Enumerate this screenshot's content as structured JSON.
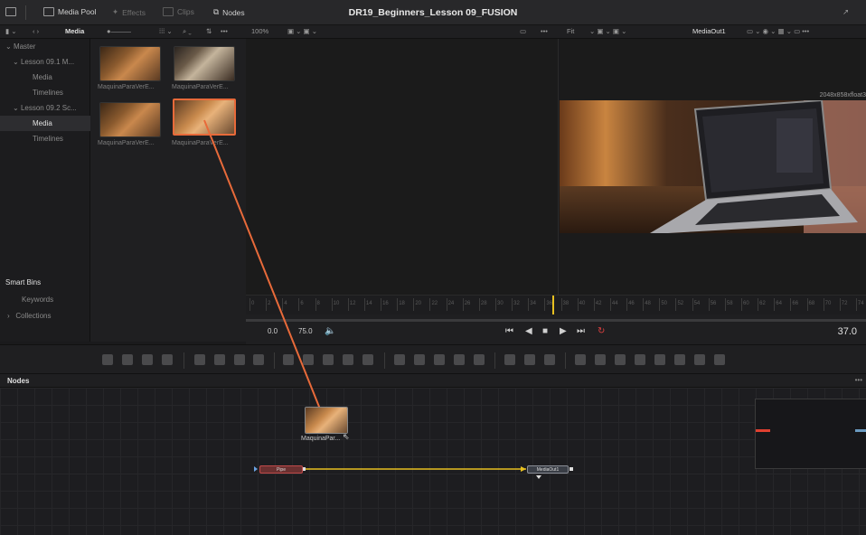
{
  "topbar": {
    "media_pool": "Media Pool",
    "effects": "Effects",
    "clips": "Clips",
    "nodes": "Nodes",
    "project_title": "DR19_Beginners_Lesson 09_FUSION"
  },
  "subbar": {
    "bin_name": "Media",
    "zoom": "100%",
    "fit": "Fit",
    "viewer_node": "MediaOut1"
  },
  "bins": {
    "master": "Master",
    "lesson1": "Lesson 09.1 M...",
    "lesson1_media": "Media",
    "lesson1_timelines": "Timelines",
    "lesson2": "Lesson 09.2 Sc...",
    "lesson2_media": "Media",
    "lesson2_timelines": "Timelines"
  },
  "smart_bins": {
    "title": "Smart Bins",
    "keywords": "Keywords",
    "collections": "Collections"
  },
  "clips": [
    {
      "name": "MaquinaParaVerE..."
    },
    {
      "name": "MaquinaParaVerE..."
    },
    {
      "name": "MaquinaParaVerE..."
    },
    {
      "name": "MaquinaParaVerE..."
    }
  ],
  "viewer": {
    "resolution": "2048x858xfloat3"
  },
  "ruler": {
    "ticks": [
      "0",
      "2",
      "4",
      "6",
      "8",
      "10",
      "12",
      "14",
      "16",
      "18",
      "20",
      "22",
      "24",
      "26",
      "28",
      "30",
      "32",
      "34",
      "36",
      "38",
      "40",
      "42",
      "44",
      "46",
      "48",
      "50",
      "52",
      "54",
      "56",
      "58",
      "60",
      "62",
      "64",
      "66",
      "68",
      "70",
      "72",
      "74"
    ],
    "playhead_frame": 37
  },
  "transport": {
    "start": "0.0",
    "end": "75.0",
    "current_frame": "37.0"
  },
  "nodes": {
    "panel_title": "Nodes",
    "pipe": "Pipe",
    "media_out": "MediaOut1",
    "media_in_label": "MaquinaPar..."
  },
  "colors": {
    "accent_orange": "#e86a3a",
    "playhead_yellow": "#e8c020",
    "pipe_red": "#c04a4a",
    "connector_yellow": "#e8c020"
  }
}
